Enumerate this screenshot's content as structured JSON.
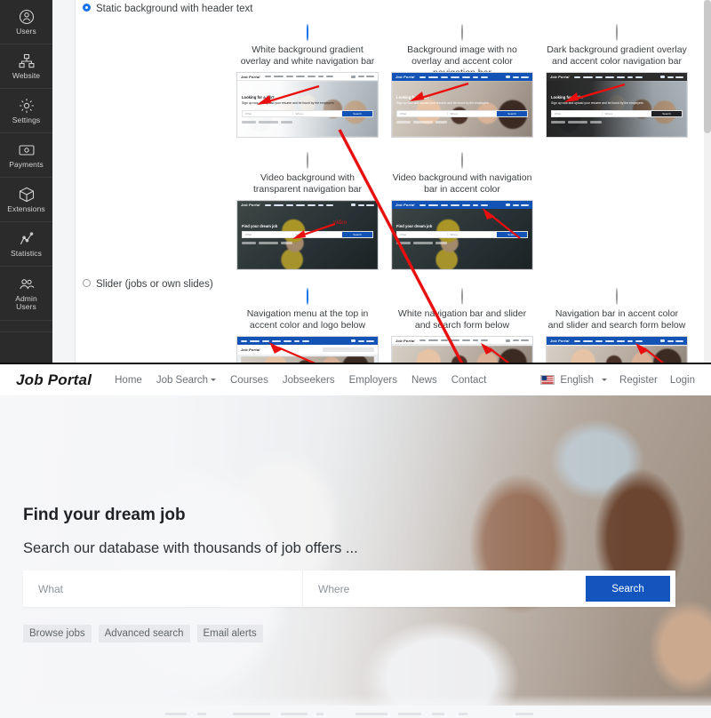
{
  "sidebar": {
    "items": [
      {
        "label": "Users",
        "icon": "user-circle-icon"
      },
      {
        "label": "Website",
        "icon": "sitemap-icon"
      },
      {
        "label": "Settings",
        "icon": "gear-icon"
      },
      {
        "label": "Payments",
        "icon": "banknote-icon"
      },
      {
        "label": "Extensions",
        "icon": "cube-icon"
      },
      {
        "label": "Statistics",
        "icon": "line-chart-icon"
      },
      {
        "label": "Admin\nUsers",
        "icon": "users-group-icon"
      }
    ]
  },
  "settings": {
    "groups": [
      {
        "key": "static",
        "label": "Static background with header text",
        "selected": true,
        "options": [
          {
            "label": "White background gradient overlay and white navigation bar",
            "selected": true,
            "preview": {
              "logo": "Job Portal",
              "headline": "Looking for a job?",
              "subline": "Sign up now and upload your resume and be found by the employers",
              "what": "What",
              "where": "Where",
              "search": "Search"
            }
          },
          {
            "label": "Background image with no overlay and accent color navigation bar",
            "selected": false,
            "preview": {
              "logo": "Job Portal",
              "headline": "Looking for a job?",
              "subline": "Sign up now and upload your resume and be found by the employers",
              "what": "What",
              "where": "Where",
              "search": "Search"
            }
          },
          {
            "label": "Dark background gradient overlay and accent color navigation bar",
            "selected": false,
            "preview": {
              "logo": "Job Portal",
              "headline": "Looking for a job?",
              "subline": "Sign up now and upload your resume and be found by the employers",
              "what": "What",
              "where": "Where",
              "search": "Search"
            }
          }
        ],
        "options_row2": [
          {
            "label": "Video background with transparent navigation bar",
            "selected": false,
            "badge": "video",
            "preview": {
              "logo": "Job Portal",
              "headline": "Find your dream job",
              "what": "What",
              "where": "Where",
              "search": "Search"
            }
          },
          {
            "label": "Video background with navigation bar in accent color",
            "selected": false,
            "preview": {
              "logo": "Job Portal",
              "headline": "Find your dream job",
              "what": "What",
              "where": "Where",
              "search": "Search"
            }
          }
        ]
      },
      {
        "key": "slider",
        "label": "Slider (jobs or own slides)",
        "selected": false,
        "options": [
          {
            "label": "Navigation menu at the top in accent color and logo below",
            "selected": true,
            "preview": {
              "logo": "Job Portal"
            }
          },
          {
            "label": "White navigation bar and slider and search form below",
            "selected": false,
            "preview": {
              "logo": "Job Portal"
            }
          },
          {
            "label": "Navigation bar in accent color and slider and search form below",
            "selected": false,
            "preview": {
              "logo": "Job Portal"
            }
          }
        ]
      }
    ]
  },
  "preview": {
    "logo": "Job Portal",
    "nav": [
      {
        "label": "Home",
        "dropdown": false
      },
      {
        "label": "Job Search",
        "dropdown": true
      },
      {
        "label": "Courses",
        "dropdown": false
      },
      {
        "label": "Jobseekers",
        "dropdown": false
      },
      {
        "label": "Employers",
        "dropdown": false
      },
      {
        "label": "News",
        "dropdown": false
      },
      {
        "label": "Contact",
        "dropdown": false
      }
    ],
    "language": {
      "label": "English",
      "flag": "us-flag-icon",
      "dropdown": true
    },
    "register_label": "Register",
    "login_label": "Login",
    "hero": {
      "title": "Find your dream job",
      "subtitle": "Search our database with thousands of job offers ...",
      "what_placeholder": "What",
      "where_placeholder": "Where",
      "what_value": "",
      "where_value": "",
      "search_label": "Search"
    },
    "chips": [
      "Browse jobs",
      "Advanced search",
      "Email alerts"
    ]
  },
  "colors": {
    "accent": "#1455bd",
    "sidebar_bg": "#2b2b2b",
    "radio_selected": "#1a73e8",
    "annotation_arrow": "#e8100f",
    "chip_bg": "#e7e9ec"
  }
}
